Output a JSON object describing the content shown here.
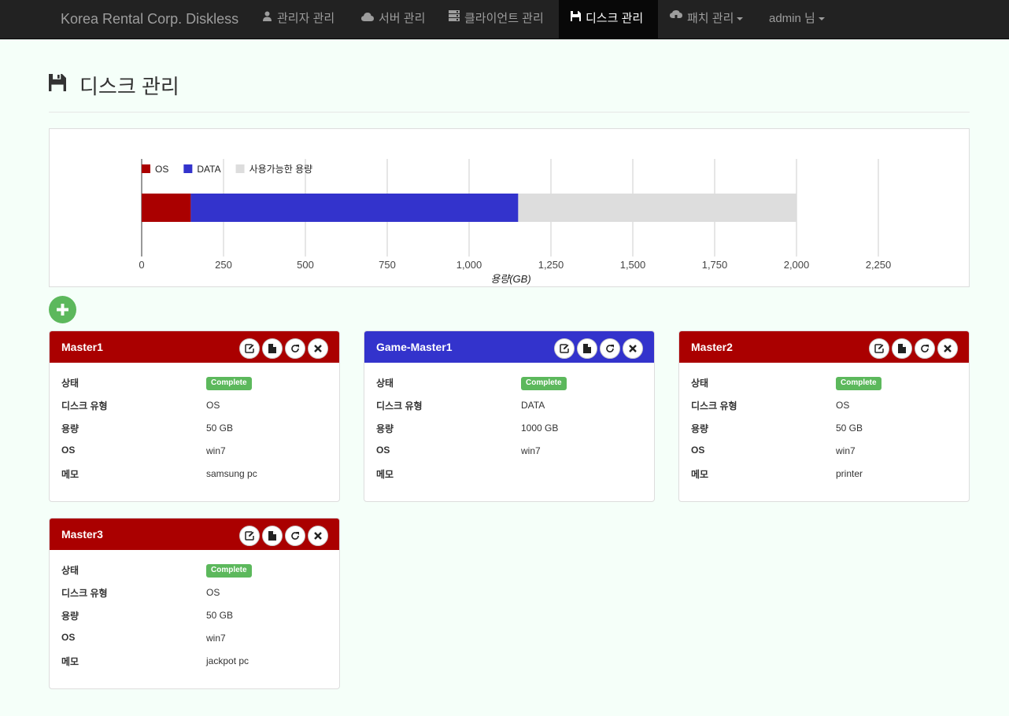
{
  "navbar": {
    "brand": "Korea Rental Corp. Diskless",
    "items": [
      {
        "label": "관리자 관리",
        "icon": "user-icon"
      },
      {
        "label": "서버 관리",
        "icon": "cloud-icon"
      },
      {
        "label": "클라이언트 관리",
        "icon": "server-icon"
      },
      {
        "label": "디스크 관리",
        "icon": "floppy-disk-icon",
        "active": true
      },
      {
        "label": "패치 관리",
        "icon": "cloud-download-icon",
        "dropdown": true
      }
    ],
    "user": "admin 님"
  },
  "page": {
    "title": "디스크 관리",
    "icon": "floppy-disk-icon",
    "add_button_icon": "plus-icon"
  },
  "chart_data": {
    "type": "bar",
    "orientation": "horizontal",
    "stacked": true,
    "series": [
      {
        "name": "OS",
        "values": [
          150
        ],
        "color": "#aa0000"
      },
      {
        "name": "DATA",
        "values": [
          1000
        ],
        "color": "#3333cc"
      },
      {
        "name": "사용가능한 용량",
        "values": [
          850
        ],
        "color": "#dddddd"
      }
    ],
    "xlabel": "용량(GB)",
    "xlim": [
      0,
      2450
    ],
    "xticks": [
      "0",
      "250",
      "500",
      "750",
      "1,000",
      "1,250",
      "1,500",
      "1,750",
      "2,000",
      "2,250"
    ],
    "tick_values": [
      0,
      250,
      500,
      750,
      1000,
      1250,
      1500,
      1750,
      2000,
      2250
    ],
    "grid": true,
    "legend_position": "top-left"
  },
  "card_labels": {
    "status": "상태",
    "disk_type": "디스크 유형",
    "capacity": "용량",
    "os": "OS",
    "memo": "메모"
  },
  "card_action_icons": [
    "edit-icon",
    "file-icon",
    "refresh-icon",
    "close-icon"
  ],
  "disks": [
    {
      "name": "Master1",
      "color": "#aa0000",
      "status": "Complete",
      "disk_type": "OS",
      "capacity": "50 GB",
      "os": "win7",
      "memo": "samsung pc"
    },
    {
      "name": "Game-Master1",
      "color": "#3333cc",
      "status": "Complete",
      "disk_type": "DATA",
      "capacity": "1000 GB",
      "os": "win7",
      "memo": ""
    },
    {
      "name": "Master2",
      "color": "#aa0000",
      "status": "Complete",
      "disk_type": "OS",
      "capacity": "50 GB",
      "os": "win7",
      "memo": "printer"
    },
    {
      "name": "Master3",
      "color": "#aa0000",
      "status": "Complete",
      "disk_type": "OS",
      "capacity": "50 GB",
      "os": "win7",
      "memo": "jackpot pc"
    }
  ]
}
